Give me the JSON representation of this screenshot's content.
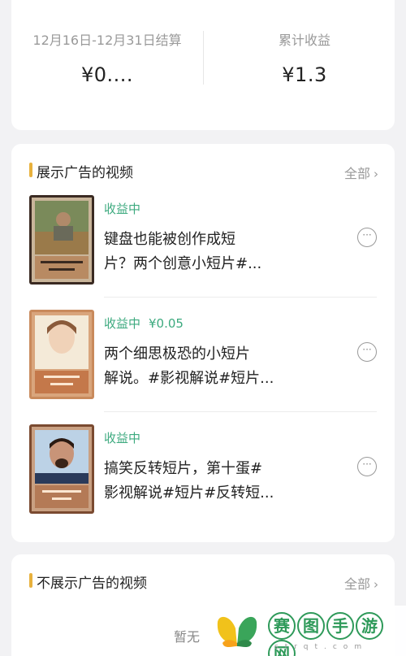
{
  "earnings": {
    "period_label": "12月16日-12月31日结算",
    "period_value": "¥0....",
    "total_label": "累计收益",
    "total_value": "¥1.3"
  },
  "ad_section": {
    "title": "展示广告的视频",
    "all_label": "全部",
    "items": [
      {
        "status": "收益中",
        "money": "",
        "line1": "键盘也能被创作成短",
        "line2": "片？两个创意小短片#..."
      },
      {
        "status": "收益中",
        "money": "¥0.05",
        "line1": "两个细思极恐的小短片",
        "line2": "解说。#影视解说#短片..."
      },
      {
        "status": "收益中",
        "money": "",
        "line1": "搞笑反转短片，第十蛋#",
        "line2": "影视解说#短片#反转短..."
      }
    ]
  },
  "no_ad_section": {
    "title": "不展示广告的视频",
    "all_label": "全部",
    "empty_text": "暂无"
  },
  "watermark": {
    "chars": [
      "赛",
      "图",
      "手",
      "游",
      "网"
    ],
    "sub": "strqt.com"
  },
  "colors": {
    "accent": "#e8b13d",
    "status_green": "#3daa7f",
    "background": "#f2f2f4"
  }
}
